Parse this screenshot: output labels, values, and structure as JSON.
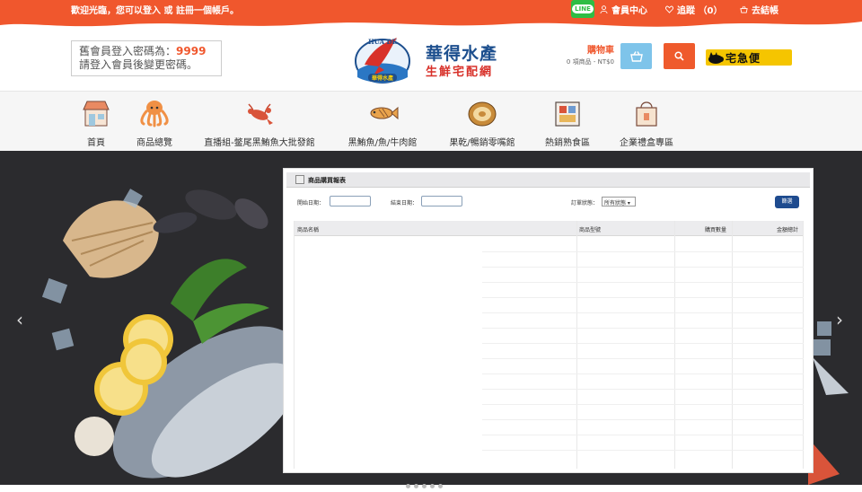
{
  "topbar": {
    "welcome_prefix": "歡迎光臨，您可以登入 或 ",
    "register_link": "註冊一個帳戶",
    "welcome_suffix": "。",
    "line_label": "LINE",
    "member_center": "會員中心",
    "tracking": "追蹤 （0）",
    "checkout": "去結帳"
  },
  "notice": {
    "line1_prefix": "舊會員登入密碼為：",
    "password": "9999",
    "line2": "請登入會員後變更密碼。"
  },
  "logo": {
    "ring_text": "HUA DE",
    "badge_text": "華得水產",
    "name": "華得水產",
    "tagline": "生鮮宅配網"
  },
  "cart": {
    "title": "購物車",
    "summary": "0 項商品 - NT$0"
  },
  "yamato_label": "宅急便",
  "nav": [
    {
      "label": "首頁",
      "icon": "store-icon"
    },
    {
      "label": "商品總覽",
      "icon": "octopus-icon"
    },
    {
      "label": "直播組-鳖尾黑鮪魚大批發館",
      "icon": "lobster-icon"
    },
    {
      "label": "黑鮪魚/魚/牛肉館",
      "icon": "fish-icon"
    },
    {
      "label": "果乾/暢銷零嘴館",
      "icon": "snack-icon"
    },
    {
      "label": "熱銷熟食區",
      "icon": "deli-icon"
    },
    {
      "label": "企業禮盒專區",
      "icon": "gift-bag-icon"
    }
  ],
  "report": {
    "title": "商品購買報表",
    "start_label": "開始日期：",
    "end_label": "結束日期：",
    "status_label": "訂單狀態：",
    "status_value": "所有狀態",
    "filter_button": "篩選",
    "columns": [
      "商品名稱",
      "商品型號",
      "購買數量",
      "金額總計"
    ]
  },
  "colors": {
    "brand_orange": "#f0572d",
    "line_green": "#2ebd44",
    "cart_blue": "#7ec4ea",
    "logo_blue": "#1d4f8e",
    "yamato_yellow": "#f5c500"
  }
}
